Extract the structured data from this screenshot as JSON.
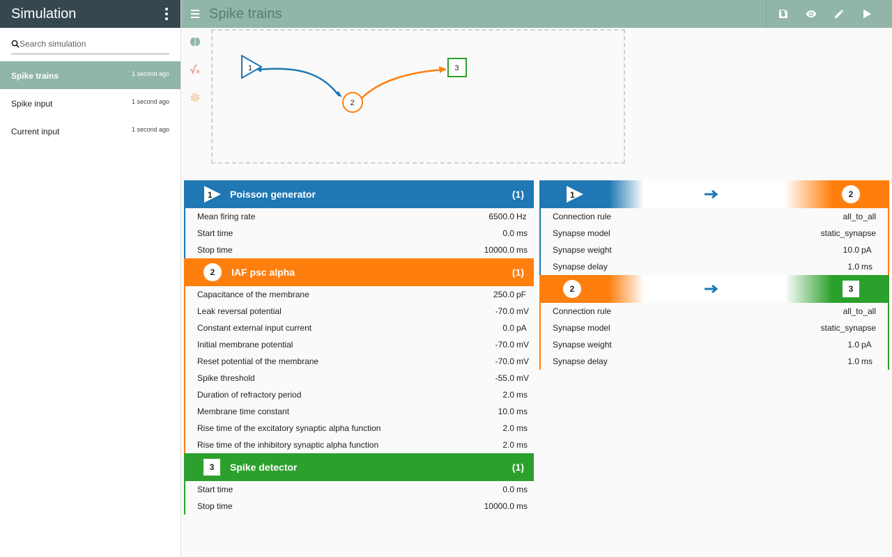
{
  "sidebar": {
    "title": "Simulation",
    "search_placeholder": "Search simulation",
    "items": [
      {
        "label": "Spike trains",
        "time": "1 second ago"
      },
      {
        "label": "Spike input",
        "time": "1 second ago"
      },
      {
        "label": "Current input",
        "time": "1 second ago"
      }
    ]
  },
  "topbar": {
    "title": "Spike trains",
    "actions": [
      "save-icon",
      "eye-icon",
      "pencil-icon",
      "play-icon"
    ]
  },
  "rail": [
    "brain-icon",
    "function-icon",
    "settings-icon"
  ],
  "colors": {
    "accent": "#91b5a9",
    "sidebar_header": "#37474f",
    "node1": "#1f77b4",
    "node2": "#ff7f0e",
    "node3": "#2ca02c"
  },
  "graph": {
    "nodes": [
      {
        "id": "1",
        "shape": "triangle",
        "color": "#1f77b4"
      },
      {
        "id": "2",
        "shape": "circle",
        "color": "#ff7f0e"
      },
      {
        "id": "3",
        "shape": "square",
        "color": "#2ca02c"
      }
    ]
  },
  "nodes": [
    {
      "id": "1",
      "name": "Poisson generator",
      "count": "(1)",
      "params": [
        {
          "name": "Mean firing rate",
          "value": "6500.0",
          "unit": "Hz"
        },
        {
          "name": "Start time",
          "value": "0.0",
          "unit": "ms"
        },
        {
          "name": "Stop time",
          "value": "10000.0",
          "unit": "ms"
        }
      ]
    },
    {
      "id": "2",
      "name": "IAF psc alpha",
      "count": "(1)",
      "params": [
        {
          "name": "Capacitance of the membrane",
          "value": "250.0",
          "unit": "pF"
        },
        {
          "name": "Leak reversal potential",
          "value": "-70.0",
          "unit": "mV"
        },
        {
          "name": "Constant external input current",
          "value": "0.0",
          "unit": "pA"
        },
        {
          "name": "Initial membrane potential",
          "value": "-70.0",
          "unit": "mV"
        },
        {
          "name": "Reset potential of the membrane",
          "value": "-70.0",
          "unit": "mV"
        },
        {
          "name": "Spike threshold",
          "value": "-55.0",
          "unit": "mV"
        },
        {
          "name": "Duration of refractory period",
          "value": "2.0",
          "unit": "ms"
        },
        {
          "name": "Membrane time constant",
          "value": "10.0",
          "unit": "ms"
        },
        {
          "name": "Rise time of the excitatory synaptic alpha function",
          "value": "2.0",
          "unit": "ms"
        },
        {
          "name": "Rise time of the inhibitory synaptic alpha function",
          "value": "2.0",
          "unit": "ms"
        }
      ]
    },
    {
      "id": "3",
      "name": "Spike detector",
      "count": "(1)",
      "params": [
        {
          "name": "Start time",
          "value": "0.0",
          "unit": "ms"
        },
        {
          "name": "Stop time",
          "value": "10000.0",
          "unit": "ms"
        }
      ]
    }
  ],
  "connections": [
    {
      "source": "1",
      "target": "2",
      "params": [
        {
          "name": "Connection rule",
          "value": "all_to_all",
          "unit": ""
        },
        {
          "name": "Synapse model",
          "value": "static_synapse",
          "unit": ""
        },
        {
          "name": "Synapse weight",
          "value": "10.0",
          "unit": "pA"
        },
        {
          "name": "Synapse delay",
          "value": "1.0",
          "unit": "ms"
        }
      ]
    },
    {
      "source": "2",
      "target": "3",
      "params": [
        {
          "name": "Connection rule",
          "value": "all_to_all",
          "unit": ""
        },
        {
          "name": "Synapse model",
          "value": "static_synapse",
          "unit": ""
        },
        {
          "name": "Synapse weight",
          "value": "1.0",
          "unit": "pA"
        },
        {
          "name": "Synapse delay",
          "value": "1.0",
          "unit": "ms"
        }
      ]
    }
  ]
}
